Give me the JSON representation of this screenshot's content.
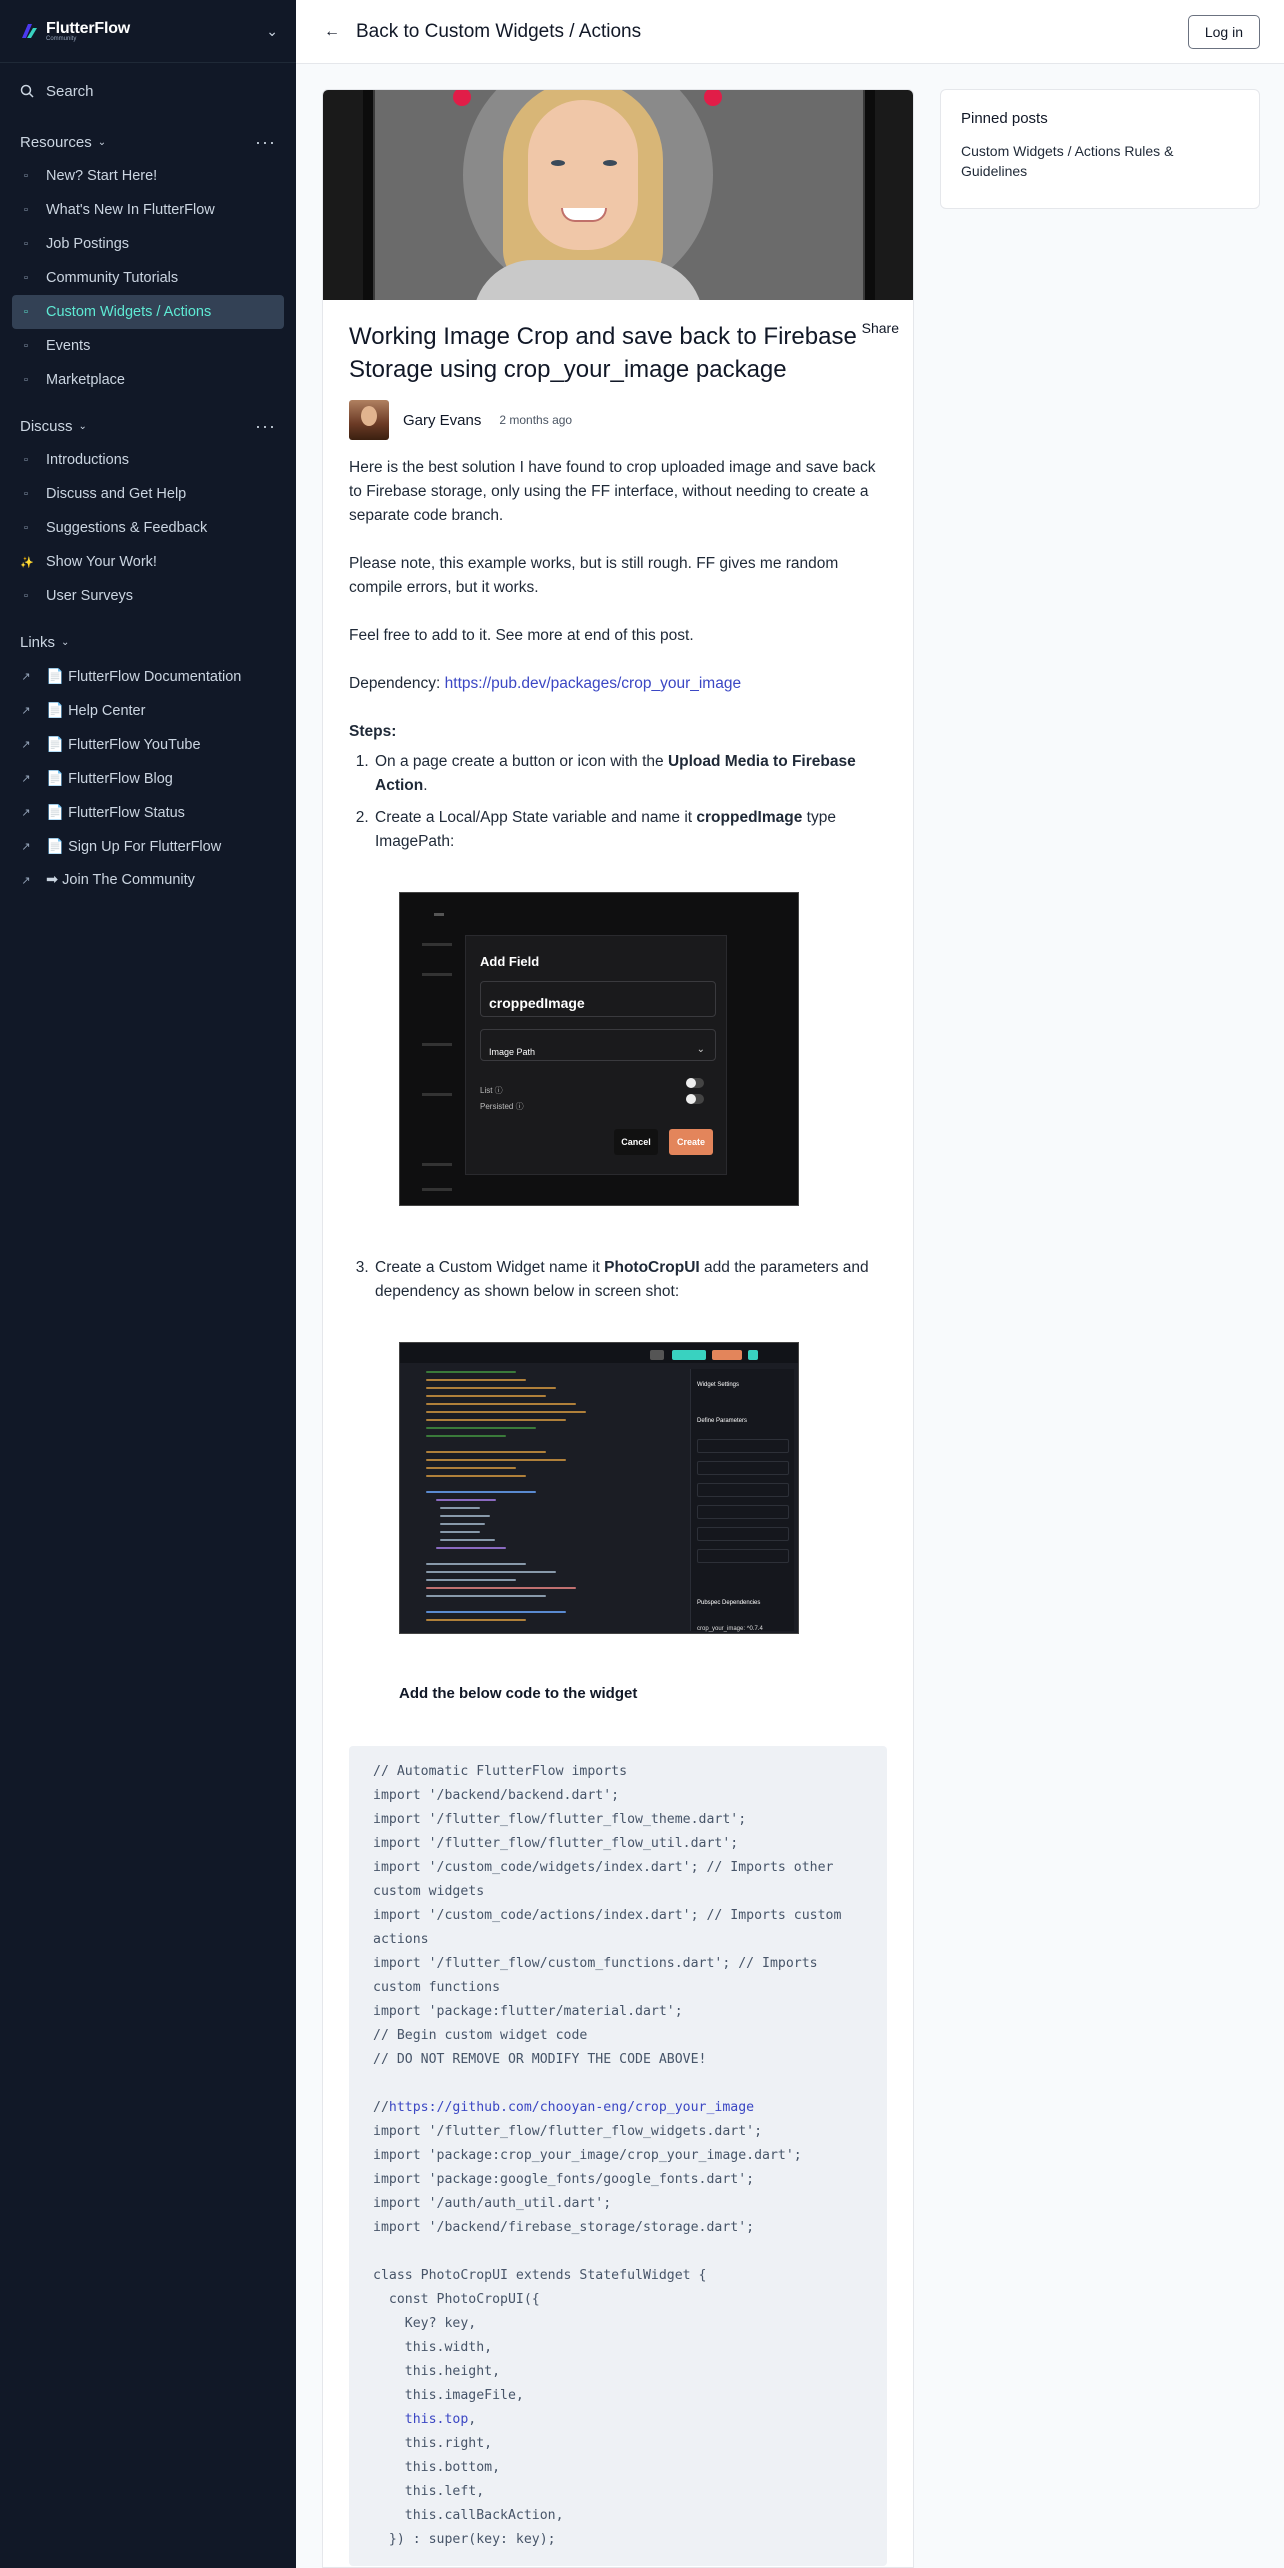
{
  "sidebar": {
    "logo": {
      "name": "FlutterFlow",
      "sub": "Community"
    },
    "search_label": "Search",
    "sections": [
      {
        "title": "Resources",
        "items": [
          {
            "label": "New? Start Here!",
            "icon": "file-icon"
          },
          {
            "label": "What's New In FlutterFlow",
            "icon": "file-icon"
          },
          {
            "label": "Job Postings",
            "icon": "file-icon"
          },
          {
            "label": "Community Tutorials",
            "icon": "file-icon"
          },
          {
            "label": "Custom Widgets / Actions",
            "icon": "file-icon",
            "active": true
          },
          {
            "label": "Events",
            "icon": "file-icon"
          },
          {
            "label": "Marketplace",
            "icon": "file-icon"
          }
        ]
      },
      {
        "title": "Discuss",
        "items": [
          {
            "label": "Introductions",
            "icon": "file-icon"
          },
          {
            "label": "Discuss and Get Help",
            "icon": "file-icon"
          },
          {
            "label": "Suggestions & Feedback",
            "icon": "file-icon"
          },
          {
            "label": "Show Your Work!",
            "icon": "sparkle-icon"
          },
          {
            "label": "User Surveys",
            "icon": "file-icon"
          }
        ]
      },
      {
        "title": "Links",
        "items": [
          {
            "label": "📄 FlutterFlow Documentation",
            "icon": "external-link-icon"
          },
          {
            "label": "📄 Help Center",
            "icon": "external-link-icon"
          },
          {
            "label": "📄 FlutterFlow YouTube",
            "icon": "external-link-icon"
          },
          {
            "label": "📄 FlutterFlow Blog",
            "icon": "external-link-icon"
          },
          {
            "label": "📄 FlutterFlow Status",
            "icon": "external-link-icon"
          },
          {
            "label": "📄 Sign Up For FlutterFlow",
            "icon": "external-link-icon"
          },
          {
            "label": "➡ Join The Community",
            "icon": "external-link-icon"
          }
        ]
      }
    ]
  },
  "topbar": {
    "back_label": "Back to Custom Widgets / Actions",
    "login_label": "Log in"
  },
  "post": {
    "title": "Working Image Crop and save back to Firebase Storage using crop_your_image package",
    "share_label": "Share",
    "author": "Gary Evans",
    "time": "2 months ago",
    "p1": "Here is the best solution I have found to crop uploaded image and save back to Firebase storage, only using the FF interface, without needing to create a separate code branch.",
    "p2": "Please note, this example works, but is still rough. FF gives me random compile errors, but it works.",
    "p3": "Feel free to add to it. See more at end of this post.",
    "dep_label": "Dependency: ",
    "dep_link": "https://pub.dev/packages/crop_your_image",
    "steps_heading": "Steps:",
    "step1_pre": " On a page create a button or icon with the ",
    "step1_bold": "Upload Media to Firebase Action",
    "step1_post": ".",
    "step2_pre": "Create a Local/App State variable and name it ",
    "step2_bold": "croppedImage",
    "step2_post": " type ImagePath:",
    "step3_pre": "Create a Custom Widget name it ",
    "step3_bold": "PhotoCropUI",
    "step3_post": " add the parameters and dependency as shown below in screen shot:",
    "add_code_label": "Add the below code to the widget"
  },
  "shot1": {
    "title": "Add Field",
    "field_value": "croppedImage",
    "select_value": "Image Path",
    "list_label": "List ⓘ",
    "persisted_label": "Persisted ⓘ",
    "cancel": "Cancel",
    "create": "Create"
  },
  "shot2": {
    "panel_title": "Widget Settings",
    "params_title": "Define Parameters",
    "deps_title": "Pubspec Dependencies",
    "dep_value": "crop_your_image: ^0.7.4"
  },
  "code": {
    "lines_a": "// Automatic FlutterFlow imports\nimport '/backend/backend.dart';\nimport '/flutter_flow/flutter_flow_theme.dart';\nimport '/flutter_flow/flutter_flow_util.dart';\nimport '/custom_code/widgets/index.dart'; // Imports other custom widgets\nimport '/custom_code/actions/index.dart'; // Imports custom actions\nimport '/flutter_flow/custom_functions.dart'; // Imports custom functions\nimport 'package:flutter/material.dart';\n// Begin custom widget code\n// DO NOT REMOVE OR MODIFY THE CODE ABOVE!\n\n",
    "link_prefix": "//",
    "link": "https://github.com/chooyan-eng/crop_your_image",
    "lines_b": "\nimport '/flutter_flow/flutter_flow_widgets.dart';\nimport 'package:crop_your_image/crop_your_image.dart';\nimport 'package:google_fonts/google_fonts.dart';\nimport '/auth/auth_util.dart';\nimport '/backend/firebase_storage/storage.dart';\n\nclass PhotoCropUI extends StatefulWidget {\n  const PhotoCropUI({\n    Key? key,\n    this.width,\n    this.height,\n    this.imageFile,\n    ",
    "kw_top": "this.top",
    "lines_c": ",\n    this.right,\n    this.bottom,\n    this.left,\n    this.callBackAction,\n  }) : super(key: key);"
  },
  "pinned": {
    "title": "Pinned posts",
    "link": "Custom Widgets / Actions Rules & Guidelines"
  }
}
